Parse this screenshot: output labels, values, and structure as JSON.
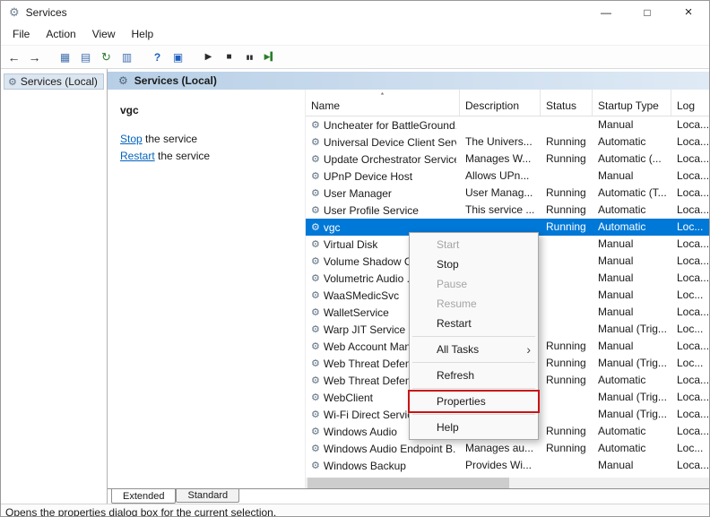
{
  "window": {
    "title": "Services",
    "minimize": "—",
    "maximize": "□",
    "close": "×"
  },
  "menubar": [
    "File",
    "Action",
    "View",
    "Help"
  ],
  "toolbar": [
    {
      "name": "back",
      "glyph": "←",
      "color": "#2b2b2b",
      "size": 14
    },
    {
      "name": "forward",
      "glyph": "→",
      "color": "#2b2b2b",
      "size": 14
    },
    {
      "name": "show-console-tree",
      "glyph": "▦",
      "color": "#3f6fae",
      "size": 12,
      "gap": true
    },
    {
      "name": "export-list",
      "glyph": "▤",
      "color": "#3f6fae",
      "size": 12
    },
    {
      "name": "refresh",
      "glyph": "↻",
      "color": "#2e7d32",
      "size": 13
    },
    {
      "name": "properties",
      "glyph": "▥",
      "color": "#3f6fae",
      "size": 12
    },
    {
      "name": "help",
      "glyph": "?",
      "color": "#1f5fbf",
      "size": 12,
      "bold": true,
      "gap": true
    },
    {
      "name": "help-topics",
      "glyph": "▣",
      "color": "#1f5fbf",
      "size": 12
    },
    {
      "name": "start-service",
      "glyph": "▶",
      "color": "#2b2b2b",
      "size": 10,
      "gap": true
    },
    {
      "name": "stop-service",
      "glyph": "■",
      "color": "#2b2b2b",
      "size": 10
    },
    {
      "name": "pause-service",
      "glyph": "▮▮",
      "color": "#2b2b2b",
      "size": 7
    },
    {
      "name": "restart-service",
      "glyph": "▶▍",
      "color": "#2b7d2b",
      "size": 9
    }
  ],
  "tree": {
    "root_label": "Services (Local)"
  },
  "content": {
    "header_title": "Services (Local)",
    "info_pane": {
      "service_name": "vgc",
      "stop_link": "Stop",
      "stop_suffix": " the service",
      "restart_link": "Restart",
      "restart_suffix": " the service"
    },
    "table": {
      "columns": [
        {
          "key": "name",
          "label": "Name",
          "sorted": true
        },
        {
          "key": "description",
          "label": "Description"
        },
        {
          "key": "status",
          "label": "Status"
        },
        {
          "key": "startup",
          "label": "Startup Type"
        },
        {
          "key": "logon",
          "label": "Log"
        }
      ],
      "rows": [
        {
          "name": "Uncheater for BattleGround...",
          "description": "",
          "status": "",
          "startup": "Manual",
          "logon": "Loca...",
          "selected": false
        },
        {
          "name": "Universal Device Client Serv...",
          "description": "The Univers...",
          "status": "Running",
          "startup": "Automatic",
          "logon": "Loca...",
          "selected": false
        },
        {
          "name": "Update Orchestrator Service",
          "description": "Manages W...",
          "status": "Running",
          "startup": "Automatic (...",
          "logon": "Loca...",
          "selected": false
        },
        {
          "name": "UPnP Device Host",
          "description": "Allows UPn...",
          "status": "",
          "startup": "Manual",
          "logon": "Loca...",
          "selected": false
        },
        {
          "name": "User Manager",
          "description": "User Manag...",
          "status": "Running",
          "startup": "Automatic (T...",
          "logon": "Loca...",
          "selected": false
        },
        {
          "name": "User Profile Service",
          "description": "This service ...",
          "status": "Running",
          "startup": "Automatic",
          "logon": "Loca...",
          "selected": false
        },
        {
          "name": "vgc",
          "description": "",
          "status": "Running",
          "startup": "Automatic",
          "logon": "Loc...",
          "selected": true
        },
        {
          "name": "Virtual Disk",
          "description": "",
          "status": "",
          "startup": "Manual",
          "logon": "Loca...",
          "selected": false
        },
        {
          "name": "Volume Shadow C...",
          "description": "",
          "status": "",
          "startup": "Manual",
          "logon": "Loca...",
          "selected": false
        },
        {
          "name": "Volumetric Audio ...",
          "description": "",
          "status": "",
          "startup": "Manual",
          "logon": "Loca...",
          "selected": false
        },
        {
          "name": "WaaSMedicSvc",
          "description": "",
          "status": "",
          "startup": "Manual",
          "logon": "Loc...",
          "selected": false
        },
        {
          "name": "WalletService",
          "description": "",
          "status": "",
          "startup": "Manual",
          "logon": "Loca...",
          "selected": false
        },
        {
          "name": "Warp JIT Service",
          "description": "",
          "status": "",
          "startup": "Manual (Trig...",
          "logon": "Loc...",
          "selected": false
        },
        {
          "name": "Web Account Man...",
          "description": "",
          "status": "Running",
          "startup": "Manual",
          "logon": "Loca...",
          "selected": false
        },
        {
          "name": "Web Threat Defen...",
          "description": "",
          "status": "Running",
          "startup": "Manual (Trig...",
          "logon": "Loc...",
          "selected": false
        },
        {
          "name": "Web Threat Defen...",
          "description": "",
          "status": "Running",
          "startup": "Automatic",
          "logon": "Loca...",
          "selected": false
        },
        {
          "name": "WebClient",
          "description": "",
          "status": "",
          "startup": "Manual (Trig...",
          "logon": "Loca...",
          "selected": false
        },
        {
          "name": "Wi-Fi Direct Servic...",
          "description": "",
          "status": "",
          "startup": "Manual (Trig...",
          "logon": "Loca...",
          "selected": false
        },
        {
          "name": "Windows Audio",
          "description": "",
          "status": "Running",
          "startup": "Automatic",
          "logon": "Loca...",
          "selected": false
        },
        {
          "name": "Windows Audio Endpoint B...",
          "description": "Manages au...",
          "status": "Running",
          "startup": "Automatic",
          "logon": "Loc...",
          "selected": false
        },
        {
          "name": "Windows Backup",
          "description": "Provides Wi...",
          "status": "",
          "startup": "Manual",
          "logon": "Loca...",
          "selected": false
        }
      ]
    },
    "tabs": [
      {
        "label": "Extended",
        "active": true
      },
      {
        "label": "Standard",
        "active": false
      }
    ]
  },
  "context_menu": {
    "items": [
      {
        "label": "Start",
        "disabled": true
      },
      {
        "label": "Stop"
      },
      {
        "label": "Pause",
        "disabled": true
      },
      {
        "label": "Resume",
        "disabled": true
      },
      {
        "label": "Restart"
      },
      {
        "separator": true
      },
      {
        "label": "All Tasks",
        "submenu": true
      },
      {
        "separator": true
      },
      {
        "label": "Refresh"
      },
      {
        "separator": true
      },
      {
        "label": "Properties",
        "highlighted": true
      },
      {
        "separator": true
      },
      {
        "label": "Help"
      }
    ]
  },
  "statusbar": "Opens the properties dialog box for the current selection."
}
